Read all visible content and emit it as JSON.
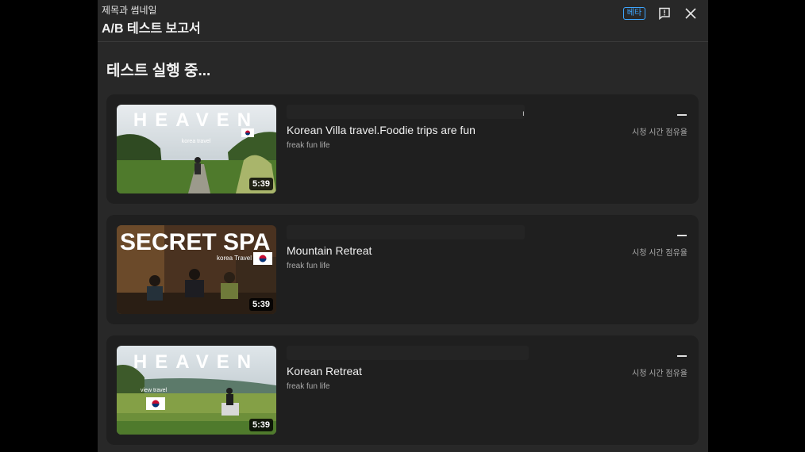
{
  "header": {
    "subtitle": "제목과 썸네일",
    "title": "A/B 테스트 보고서",
    "beta_label": "베타",
    "feedback_icon": "feedback-icon",
    "close_icon": "close-icon"
  },
  "section_title": "테스트 실행 중...",
  "variants": [
    {
      "title": "Korean Villa travel.Foodie trips are fun",
      "channel": "freak fun life",
      "duration": "5:39",
      "metric_value": "—",
      "metric_label": "시청 시간 점유율",
      "thumb_text": "HEAVEN",
      "thumb_small": "korea travel",
      "tick": "ı"
    },
    {
      "title": "Mountain Retreat",
      "channel": "freak fun life",
      "duration": "5:39",
      "metric_value": "—",
      "metric_label": "시청 시간 점유율",
      "thumb_text": "SECRET SPA",
      "thumb_small": "korea Travel"
    },
    {
      "title": "Korean Retreat",
      "channel": "freak fun life",
      "duration": "5:39",
      "metric_value": "—",
      "metric_label": "시청 시간 점유율",
      "thumb_text": "HEAVEN",
      "thumb_small": "view travel"
    }
  ],
  "colors": {
    "panel": "#282828",
    "card": "#1f1f1f",
    "accent": "#3ea6ff"
  }
}
